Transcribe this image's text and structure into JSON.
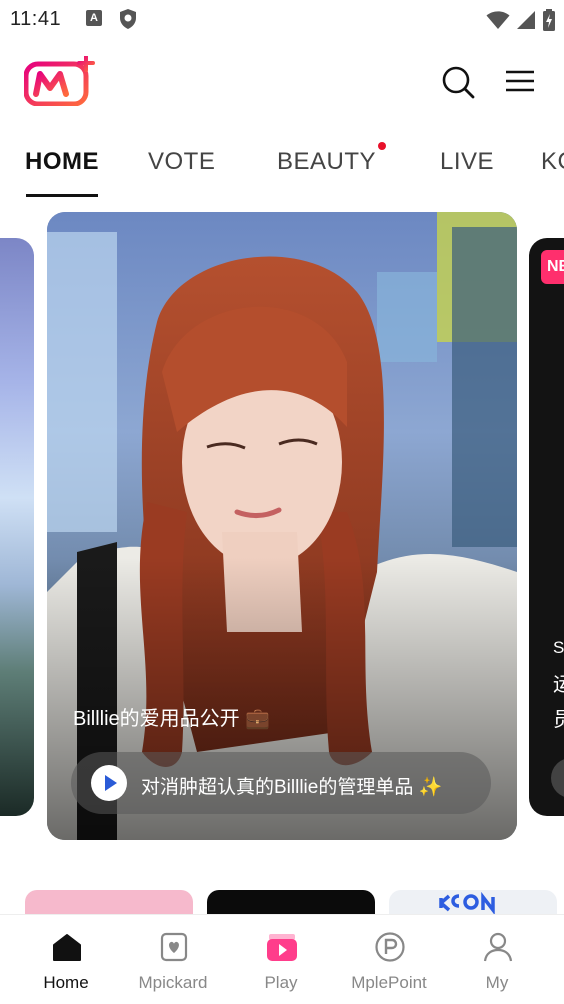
{
  "status_bar": {
    "time": "11:41",
    "a_icon_letter": "A"
  },
  "header": {
    "logo_name": "mnet-plus-logo",
    "brand_colors": {
      "magenta": "#e6007e",
      "pink": "#ff3d8b",
      "orange": "#ff6a3d"
    }
  },
  "tabs": [
    {
      "label": "HOME",
      "active": true
    },
    {
      "label": "VOTE",
      "active": false
    },
    {
      "label": "BEAUTY",
      "active": false,
      "has_dot": true
    },
    {
      "label": "LIVE",
      "active": false
    },
    {
      "label": "KC",
      "active": false
    }
  ],
  "carousel": {
    "main_card": {
      "caption": "Billlie的爱用品公开 💼",
      "pill_text": "对消肿超认真的Billlie的管理单品 ✨"
    },
    "right_card": {
      "badge": "NE",
      "text_top": "S",
      "text_line2": "运",
      "text_line3": "员"
    }
  },
  "bottom_nav": [
    {
      "label": "Home",
      "icon": "home-icon",
      "active": true
    },
    {
      "label": "Mpickard",
      "icon": "mpickard-icon",
      "active": false
    },
    {
      "label": "Play",
      "icon": "play-icon",
      "active": false
    },
    {
      "label": "MplePoint",
      "icon": "mplepoint-icon",
      "active": false
    },
    {
      "label": "My",
      "icon": "profile-icon",
      "active": false
    }
  ],
  "colors": {
    "accent": "#ff3d8b",
    "notification_dot": "#e8102a",
    "new_badge": "#ff2f6d"
  }
}
